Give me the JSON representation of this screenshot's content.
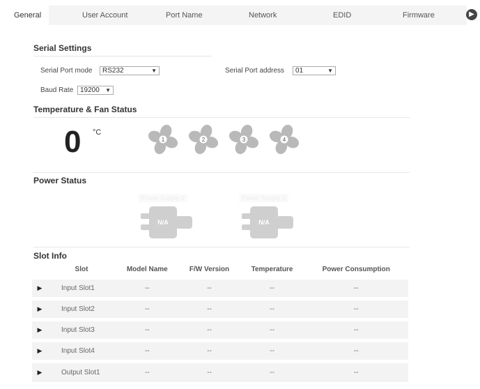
{
  "tabs": [
    {
      "label": "General"
    },
    {
      "label": "User Account"
    },
    {
      "label": "Port Name"
    },
    {
      "label": "Network"
    },
    {
      "label": "EDID"
    },
    {
      "label": "Firmware"
    }
  ],
  "next_icon": "chevron-right-icon",
  "serial": {
    "title": "Serial Settings",
    "port_mode_label": "Serial Port mode",
    "port_mode_value": "RS232",
    "address_label": "Serial Port address",
    "address_value": "01",
    "baud_label": "Baud Rate",
    "baud_value": "19200"
  },
  "temperature": {
    "title": "Temperature & Fan Status",
    "value": "0",
    "unit": "°C",
    "fans": [
      "1",
      "2",
      "3",
      "4"
    ]
  },
  "power": {
    "title": "Power Status",
    "supplies": [
      {
        "label": "Power Supply 1",
        "badge": "N/A"
      },
      {
        "label": "Power Supply 2",
        "badge": "N/A"
      }
    ]
  },
  "slot_info": {
    "title": "Slot Info",
    "columns": [
      "Slot",
      "Model Name",
      "F/W Version",
      "Temperature",
      "Power Consumption"
    ],
    "rows": [
      {
        "slot": "Input Slot1",
        "model": "--",
        "fw": "--",
        "temp": "--",
        "power": "--"
      },
      {
        "slot": "Input Slot2",
        "model": "--",
        "fw": "--",
        "temp": "--",
        "power": "--"
      },
      {
        "slot": "Input Slot3",
        "model": "--",
        "fw": "--",
        "temp": "--",
        "power": "--"
      },
      {
        "slot": "Input Slot4",
        "model": "--",
        "fw": "--",
        "temp": "--",
        "power": "--"
      },
      {
        "slot": "Output Slot1",
        "model": "--",
        "fw": "--",
        "temp": "--",
        "power": "--"
      }
    ]
  },
  "colors": {
    "fan": "#b9b9b9",
    "psu": "#cfcfcf",
    "row_bg": "#f3f3f3"
  }
}
